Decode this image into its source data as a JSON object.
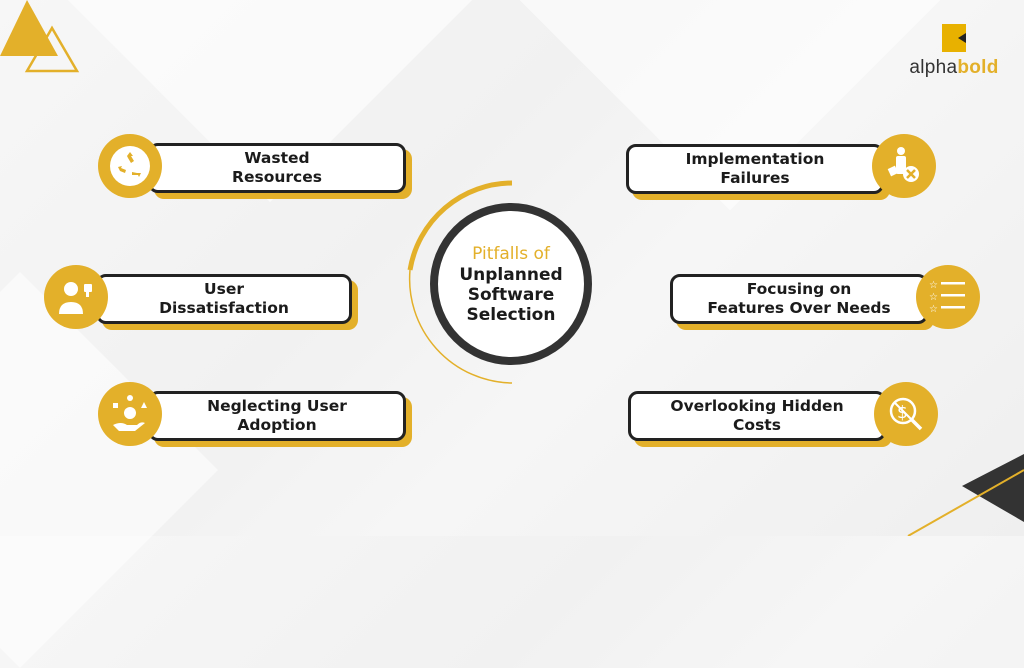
{
  "brand": {
    "logo_word_part1": "alpha",
    "logo_word_part2": "bold",
    "accent_color": "#e3b02a",
    "dark_color": "#333333"
  },
  "center": {
    "title_line1": "Pitfalls of",
    "title_line2": "Unplanned\nSoftware\nSelection"
  },
  "pitfalls": [
    {
      "label": "Wasted\nResources",
      "icon": "recycle-icon",
      "side": "left"
    },
    {
      "label": "User\nDissatisfaction",
      "icon": "thumbs-down-user-icon",
      "side": "left"
    },
    {
      "label": "Neglecting User\nAdoption",
      "icon": "user-adoption-hand-icon",
      "side": "left"
    },
    {
      "label": "Implementation\nFailures",
      "icon": "failed-user-icon",
      "side": "right"
    },
    {
      "label": "Focusing on\nFeatures Over Needs",
      "icon": "star-list-icon",
      "side": "right"
    },
    {
      "label": "Overlooking Hidden\nCosts",
      "icon": "no-dollar-search-icon",
      "side": "right"
    }
  ]
}
